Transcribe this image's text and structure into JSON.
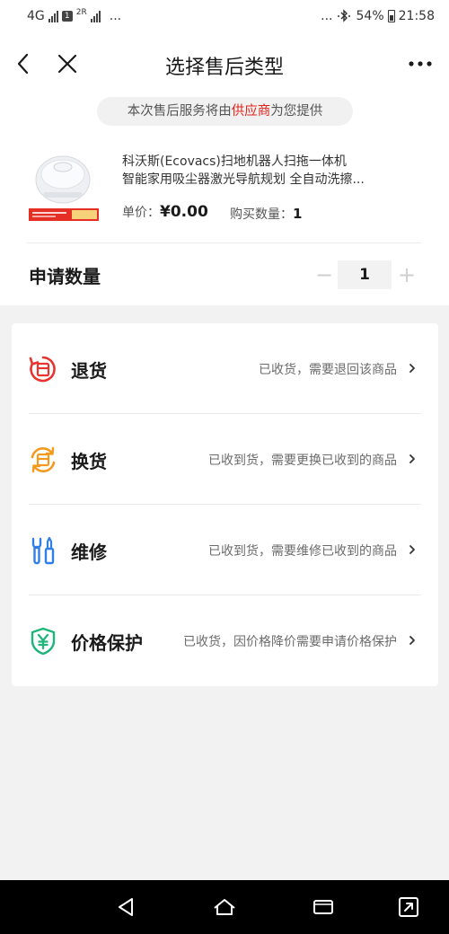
{
  "status_bar": {
    "network_label": "4G",
    "sim1_badge": "1",
    "sim2_label": "2R",
    "left_dots": "...",
    "right_dots": "...",
    "battery": "54%",
    "time": "21:58"
  },
  "nav": {
    "title": "选择售后类型",
    "back_icon": "chevron-left-icon",
    "close_icon": "close-icon",
    "more_icon": "more-dots-icon"
  },
  "notice": {
    "prefix": "本次售后服务将由",
    "highlight": "供应商",
    "suffix": "为您提供",
    "highlight_color": "#e2231a"
  },
  "product": {
    "title_line1": "科沃斯(Ecovacs)扫地机器人扫拖一体机",
    "title_line2": "智能家用吸尘器激光导航规划 全自动洗擦...",
    "price_label": "单价：",
    "price_value": "¥0.00",
    "qty_label": "购买数量：",
    "qty_value": "1"
  },
  "apply": {
    "label": "申请数量",
    "minus": "−",
    "value": "1",
    "plus": "+"
  },
  "options": [
    {
      "label": "退货",
      "desc": "已收货，需要退回该商品",
      "icon": "return-icon",
      "color": "#e8332e"
    },
    {
      "label": "换货",
      "desc": "已收到货，需要更换已收到的商品",
      "icon": "exchange-icon",
      "color": "#f39a1e"
    },
    {
      "label": "维修",
      "desc": "已收到货，需要维修已收到的商品",
      "icon": "repair-icon",
      "color": "#2f7fe6"
    },
    {
      "label": "价格保护",
      "desc": "已收货，因价格降价需要申请价格保护",
      "icon": "price-protect-icon",
      "color": "#1fb47a"
    }
  ],
  "android_nav": {
    "back": "nav-back-icon",
    "home": "nav-home-icon",
    "recent": "nav-recent-icon",
    "assist": "nav-expand-icon"
  }
}
